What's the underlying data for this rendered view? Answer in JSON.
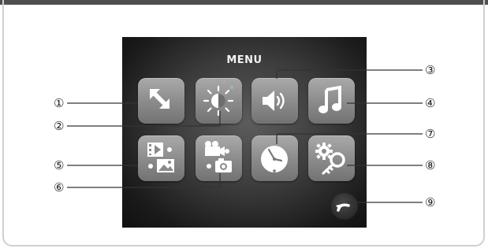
{
  "menu": {
    "title": "MENU",
    "items": [
      {
        "number": "①",
        "icon": "fullscreen-icon"
      },
      {
        "number": "②",
        "icon": "brightness-icon"
      },
      {
        "number": "③",
        "icon": "volume-icon"
      },
      {
        "number": "④",
        "icon": "music-note-icon"
      },
      {
        "number": "⑤",
        "icon": "video-photo-playback-icon"
      },
      {
        "number": "⑥",
        "icon": "camera-mode-icon"
      },
      {
        "number": "⑦",
        "icon": "clock-icon"
      },
      {
        "number": "⑧",
        "icon": "settings-key-icon"
      },
      {
        "number": "⑨",
        "icon": "back-arrow-icon"
      }
    ]
  },
  "colors": {
    "screen": "#2e2e2e",
    "tile": "#8f8f8f",
    "glyph": "#ffffff",
    "topbar": "#4f4f4f"
  }
}
